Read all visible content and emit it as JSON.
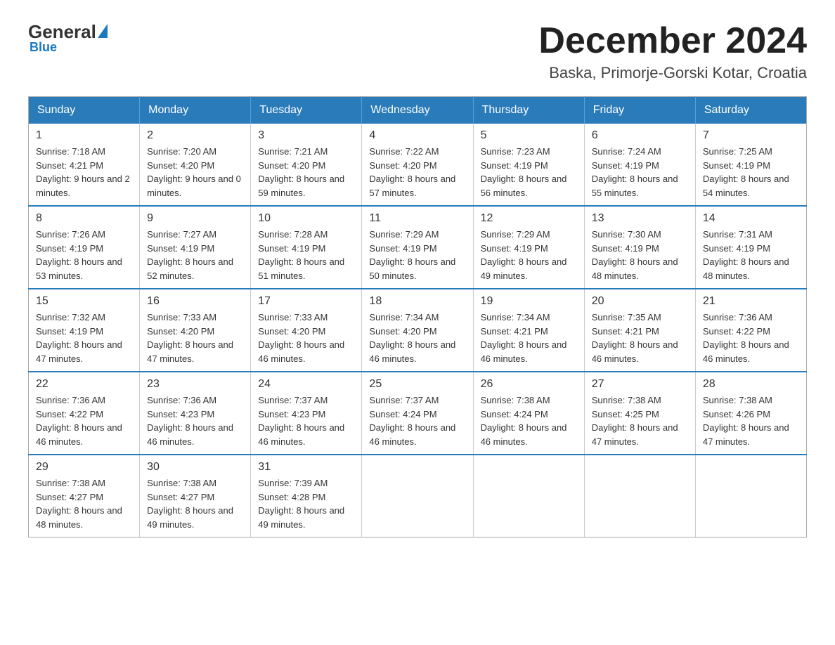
{
  "logo": {
    "general": "General",
    "blue": "Blue",
    "underline": "Blue"
  },
  "title": "December 2024",
  "subtitle": "Baska, Primorje-Gorski Kotar, Croatia",
  "headers": [
    "Sunday",
    "Monday",
    "Tuesday",
    "Wednesday",
    "Thursday",
    "Friday",
    "Saturday"
  ],
  "weeks": [
    [
      {
        "day": "1",
        "sunrise": "7:18 AM",
        "sunset": "4:21 PM",
        "daylight": "9 hours and 2 minutes."
      },
      {
        "day": "2",
        "sunrise": "7:20 AM",
        "sunset": "4:20 PM",
        "daylight": "9 hours and 0 minutes."
      },
      {
        "day": "3",
        "sunrise": "7:21 AM",
        "sunset": "4:20 PM",
        "daylight": "8 hours and 59 minutes."
      },
      {
        "day": "4",
        "sunrise": "7:22 AM",
        "sunset": "4:20 PM",
        "daylight": "8 hours and 57 minutes."
      },
      {
        "day": "5",
        "sunrise": "7:23 AM",
        "sunset": "4:19 PM",
        "daylight": "8 hours and 56 minutes."
      },
      {
        "day": "6",
        "sunrise": "7:24 AM",
        "sunset": "4:19 PM",
        "daylight": "8 hours and 55 minutes."
      },
      {
        "day": "7",
        "sunrise": "7:25 AM",
        "sunset": "4:19 PM",
        "daylight": "8 hours and 54 minutes."
      }
    ],
    [
      {
        "day": "8",
        "sunrise": "7:26 AM",
        "sunset": "4:19 PM",
        "daylight": "8 hours and 53 minutes."
      },
      {
        "day": "9",
        "sunrise": "7:27 AM",
        "sunset": "4:19 PM",
        "daylight": "8 hours and 52 minutes."
      },
      {
        "day": "10",
        "sunrise": "7:28 AM",
        "sunset": "4:19 PM",
        "daylight": "8 hours and 51 minutes."
      },
      {
        "day": "11",
        "sunrise": "7:29 AM",
        "sunset": "4:19 PM",
        "daylight": "8 hours and 50 minutes."
      },
      {
        "day": "12",
        "sunrise": "7:29 AM",
        "sunset": "4:19 PM",
        "daylight": "8 hours and 49 minutes."
      },
      {
        "day": "13",
        "sunrise": "7:30 AM",
        "sunset": "4:19 PM",
        "daylight": "8 hours and 48 minutes."
      },
      {
        "day": "14",
        "sunrise": "7:31 AM",
        "sunset": "4:19 PM",
        "daylight": "8 hours and 48 minutes."
      }
    ],
    [
      {
        "day": "15",
        "sunrise": "7:32 AM",
        "sunset": "4:19 PM",
        "daylight": "8 hours and 47 minutes."
      },
      {
        "day": "16",
        "sunrise": "7:33 AM",
        "sunset": "4:20 PM",
        "daylight": "8 hours and 47 minutes."
      },
      {
        "day": "17",
        "sunrise": "7:33 AM",
        "sunset": "4:20 PM",
        "daylight": "8 hours and 46 minutes."
      },
      {
        "day": "18",
        "sunrise": "7:34 AM",
        "sunset": "4:20 PM",
        "daylight": "8 hours and 46 minutes."
      },
      {
        "day": "19",
        "sunrise": "7:34 AM",
        "sunset": "4:21 PM",
        "daylight": "8 hours and 46 minutes."
      },
      {
        "day": "20",
        "sunrise": "7:35 AM",
        "sunset": "4:21 PM",
        "daylight": "8 hours and 46 minutes."
      },
      {
        "day": "21",
        "sunrise": "7:36 AM",
        "sunset": "4:22 PM",
        "daylight": "8 hours and 46 minutes."
      }
    ],
    [
      {
        "day": "22",
        "sunrise": "7:36 AM",
        "sunset": "4:22 PM",
        "daylight": "8 hours and 46 minutes."
      },
      {
        "day": "23",
        "sunrise": "7:36 AM",
        "sunset": "4:23 PM",
        "daylight": "8 hours and 46 minutes."
      },
      {
        "day": "24",
        "sunrise": "7:37 AM",
        "sunset": "4:23 PM",
        "daylight": "8 hours and 46 minutes."
      },
      {
        "day": "25",
        "sunrise": "7:37 AM",
        "sunset": "4:24 PM",
        "daylight": "8 hours and 46 minutes."
      },
      {
        "day": "26",
        "sunrise": "7:38 AM",
        "sunset": "4:24 PM",
        "daylight": "8 hours and 46 minutes."
      },
      {
        "day": "27",
        "sunrise": "7:38 AM",
        "sunset": "4:25 PM",
        "daylight": "8 hours and 47 minutes."
      },
      {
        "day": "28",
        "sunrise": "7:38 AM",
        "sunset": "4:26 PM",
        "daylight": "8 hours and 47 minutes."
      }
    ],
    [
      {
        "day": "29",
        "sunrise": "7:38 AM",
        "sunset": "4:27 PM",
        "daylight": "8 hours and 48 minutes."
      },
      {
        "day": "30",
        "sunrise": "7:38 AM",
        "sunset": "4:27 PM",
        "daylight": "8 hours and 49 minutes."
      },
      {
        "day": "31",
        "sunrise": "7:39 AM",
        "sunset": "4:28 PM",
        "daylight": "8 hours and 49 minutes."
      },
      null,
      null,
      null,
      null
    ]
  ]
}
